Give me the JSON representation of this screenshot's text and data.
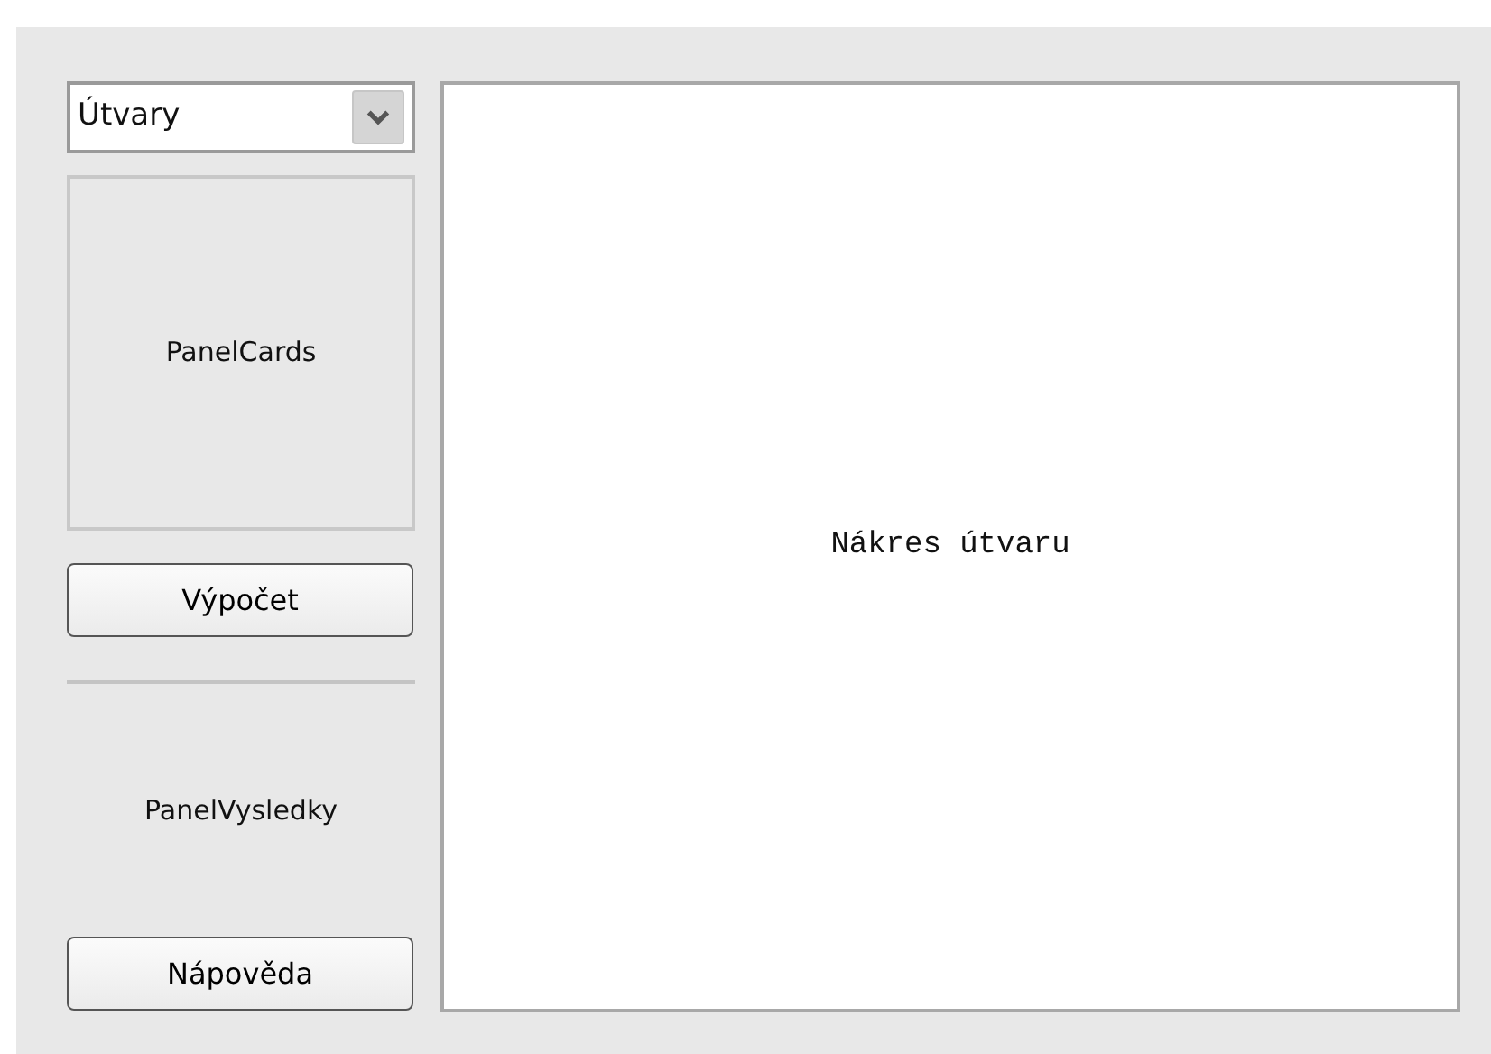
{
  "shape_select": {
    "value": "Útvary"
  },
  "cards_panel": {
    "label": "PanelCards"
  },
  "compute_button": {
    "label": "Výpočet"
  },
  "results_panel": {
    "label": "PanelVysledky"
  },
  "help_button": {
    "label": "Nápověda"
  },
  "drawing_panel": {
    "label": "Nákres útvaru"
  }
}
